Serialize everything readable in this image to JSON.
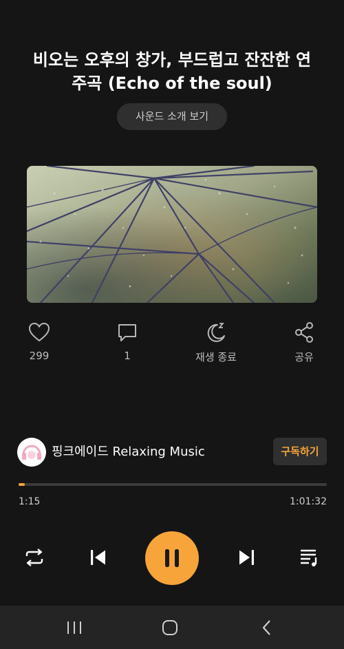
{
  "track": {
    "title_line1": "비오는 오후의 창가, 부드럽고 잔잔한 연",
    "title_line2": "주곡 (Echo of the soul)"
  },
  "intro_button": {
    "label": "사운드 소개 보기"
  },
  "actions": {
    "like": {
      "icon": "heart-icon",
      "label": "299"
    },
    "comment": {
      "icon": "speech-bubble-icon",
      "label": "1"
    },
    "sleep_timer": {
      "icon": "moon-z-icon",
      "label": "재생 종료"
    },
    "share": {
      "icon": "share-icon",
      "label": "공유"
    }
  },
  "channel": {
    "name": "핑크에이드 Relaxing Music",
    "subscribe_label": "구독하기"
  },
  "player": {
    "current_time": "1:15",
    "total_time": "1:01:32",
    "progress_fraction": 0.02
  },
  "colors": {
    "accent": "#f7a43a",
    "background": "#151515",
    "nav_background": "#242424"
  },
  "navbar": {
    "icons": [
      "recent-apps-icon",
      "home-icon",
      "back-icon"
    ]
  }
}
